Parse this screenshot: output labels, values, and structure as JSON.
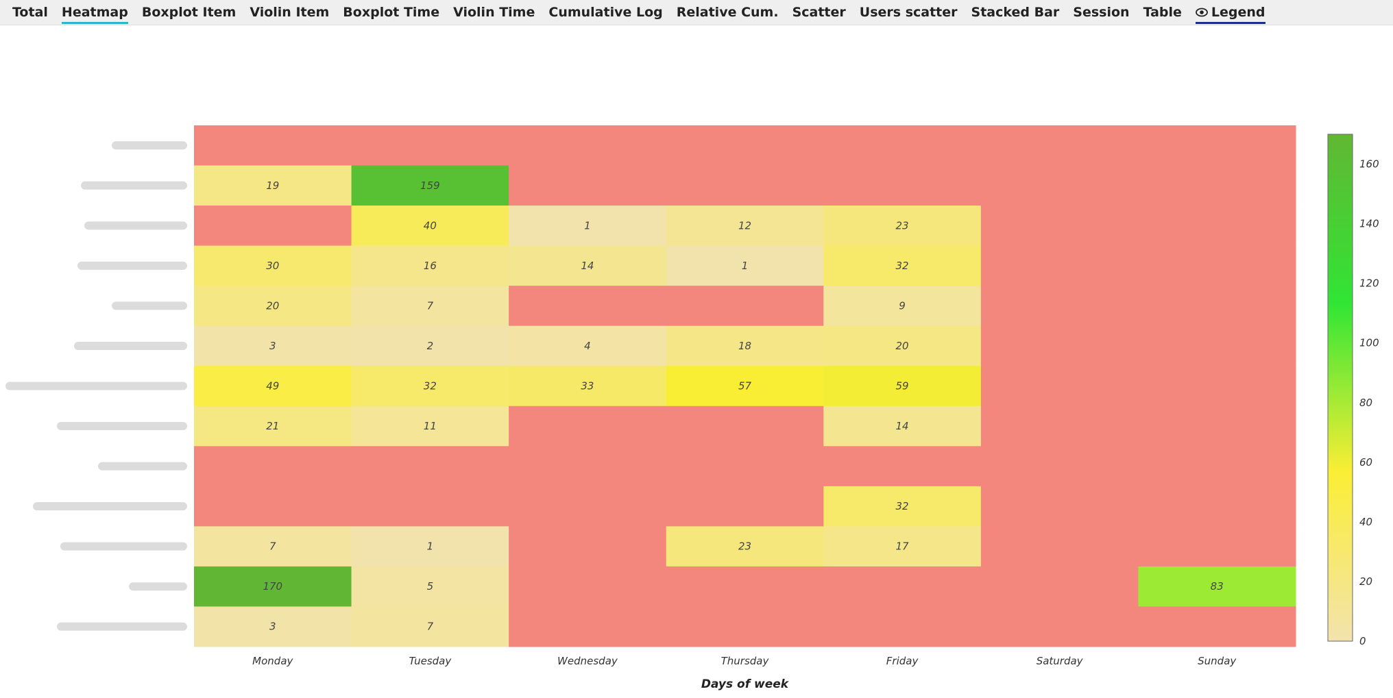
{
  "tabs": [
    {
      "label": "Total",
      "active": false
    },
    {
      "label": "Heatmap",
      "active": true
    },
    {
      "label": "Boxplot Item",
      "active": false
    },
    {
      "label": "Violin Item",
      "active": false
    },
    {
      "label": "Boxplot Time",
      "active": false
    },
    {
      "label": "Violin Time",
      "active": false
    },
    {
      "label": "Cumulative Log",
      "active": false
    },
    {
      "label": "Relative Cum.",
      "active": false
    },
    {
      "label": "Scatter",
      "active": false
    },
    {
      "label": "Users scatter",
      "active": false
    },
    {
      "label": "Stacked Bar",
      "active": false
    },
    {
      "label": "Session",
      "active": false
    },
    {
      "label": "Table",
      "active": false
    }
  ],
  "legend_tab": {
    "label": "Legend",
    "icon": "eye-icon"
  },
  "chart_data": {
    "type": "heatmap",
    "xlabel": "Days of week",
    "x": [
      "Monday",
      "Tuesday",
      "Wednesday",
      "Thursday",
      "Friday",
      "Saturday",
      "Sunday"
    ],
    "y_labels_visible": false,
    "rows": 13,
    "values": [
      [
        null,
        null,
        null,
        null,
        null,
        null,
        null
      ],
      [
        19,
        159,
        null,
        null,
        null,
        null,
        null
      ],
      [
        null,
        40,
        1,
        12,
        23,
        null,
        null
      ],
      [
        30,
        16,
        14,
        1,
        32,
        null,
        null
      ],
      [
        20,
        7,
        null,
        null,
        9,
        null,
        null
      ],
      [
        3,
        2,
        4,
        18,
        20,
        null,
        null
      ],
      [
        49,
        32,
        33,
        57,
        59,
        null,
        null
      ],
      [
        21,
        11,
        null,
        null,
        14,
        null,
        null
      ],
      [
        null,
        null,
        null,
        null,
        null,
        null,
        null
      ],
      [
        null,
        null,
        null,
        null,
        32,
        null,
        null
      ],
      [
        7,
        1,
        null,
        23,
        17,
        null,
        null
      ],
      [
        170,
        5,
        null,
        null,
        null,
        null,
        83
      ],
      [
        3,
        7,
        null,
        null,
        null,
        null,
        null
      ]
    ],
    "empty_color": "#f4877d",
    "colorscale": [
      "#f2e3ae",
      "#fbee35",
      "#31e535",
      "#61b733"
    ],
    "zmin": 0,
    "zmax": 170,
    "colorbar_ticks": [
      0,
      20,
      40,
      60,
      80,
      100,
      120,
      140,
      160
    ]
  }
}
